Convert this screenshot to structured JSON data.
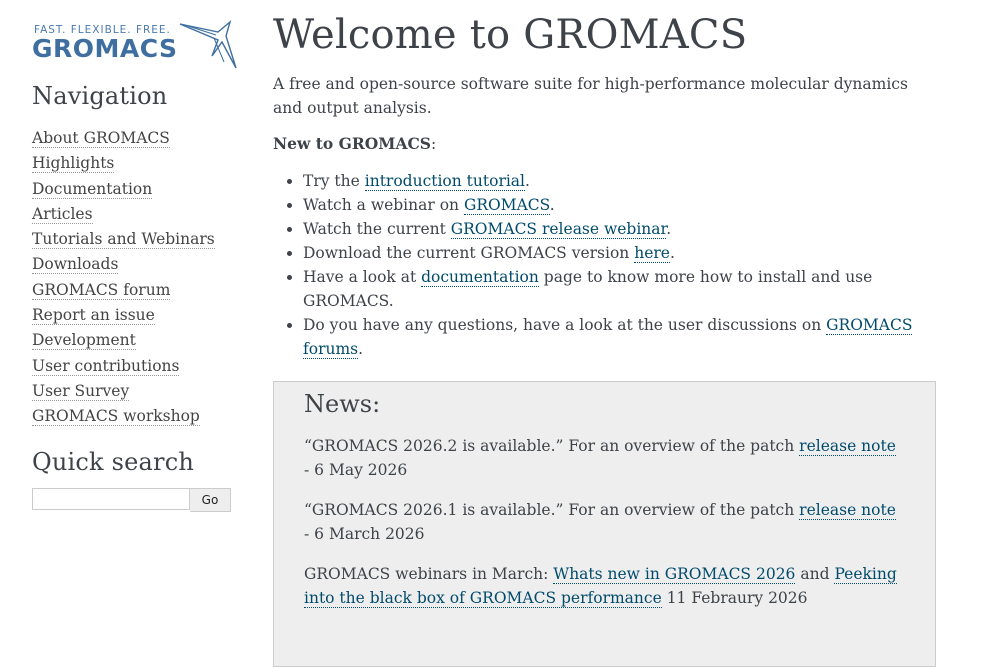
{
  "logo": {
    "tagline": "FAST. FLEXIBLE. FREE.",
    "name": "GROMACS"
  },
  "sidebar": {
    "nav_heading": "Navigation",
    "nav_items": [
      "About GROMACS",
      "Highlights",
      "Documentation",
      "Articles",
      "Tutorials and Webinars",
      "Downloads",
      "GROMACS forum",
      "Report an issue",
      "Development",
      "User contributions",
      "User Survey",
      "GROMACS workshop"
    ],
    "search_heading": "Quick search",
    "search_value": "",
    "search_button": "Go"
  },
  "main": {
    "title": "Welcome to GROMACS",
    "lead": "A free and open-source software suite for high-performance molecular dynamics and output analysis.",
    "new_to_bold": "New to GROMACS",
    "new_to_colon": ":",
    "bullets": [
      {
        "pre": "Try the ",
        "link": "introduction tutorial",
        "post": "."
      },
      {
        "pre": "Watch a webinar on ",
        "link": "GROMACS",
        "post": "."
      },
      {
        "pre": "Watch the current ",
        "link": "GROMACS release webinar",
        "post": "."
      },
      {
        "pre": "Download the current GROMACS version ",
        "link": "here",
        "post": "."
      },
      {
        "pre": "Have a look at ",
        "link": "documentation",
        "post": " page to know more how to install and use GROMACS."
      },
      {
        "pre": "Do you have any questions, have a look at the user discussions on ",
        "link": "GROMACS forums",
        "post": "."
      }
    ]
  },
  "news": {
    "title": "News:",
    "items": [
      {
        "pre": "“GROMACS 2026.2 is available.” For an overview of the patch ",
        "link": "release note",
        "post": " - 6 May 2026"
      },
      {
        "pre": "“GROMACS 2026.1 is available.” For an overview of the patch ",
        "link": "release note",
        "post": " - 6 March 2026"
      },
      {
        "pre": "GROMACS webinars in March: ",
        "link": "Whats new in GROMACS 2026",
        "mid": " and ",
        "link2": "Peeking into the black box of GROMACS performance",
        "post": " 11 Febraury 2026"
      }
    ]
  },
  "colors": {
    "link": "#004b6b",
    "logo_blue": "#3f6fa0",
    "news_bg": "#eeeeee",
    "text": "#3e4349"
  }
}
